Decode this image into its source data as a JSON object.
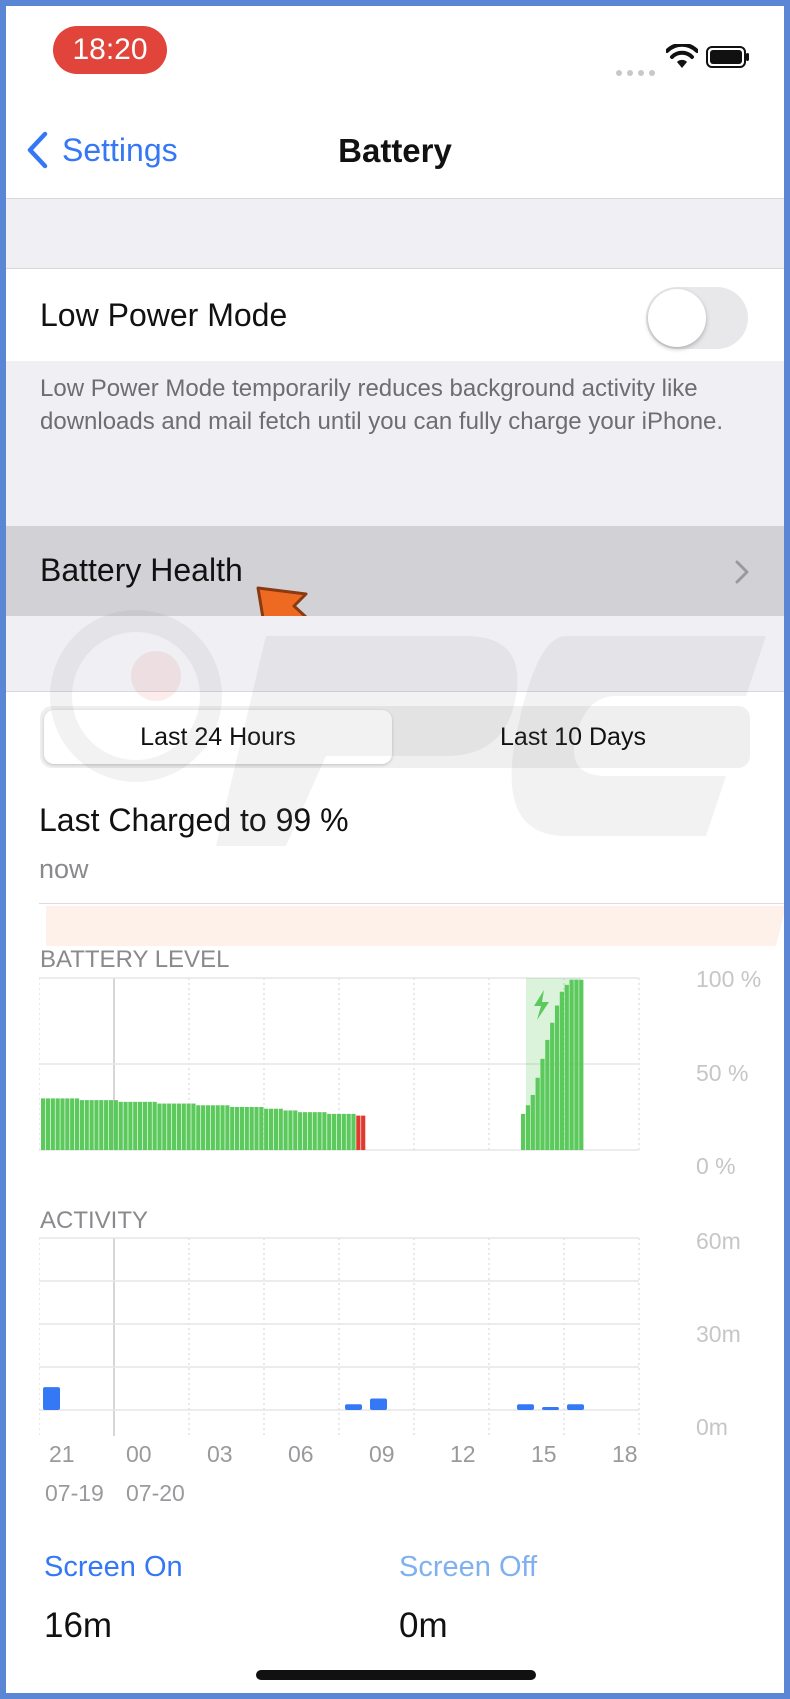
{
  "status_bar": {
    "time": "18:20"
  },
  "nav": {
    "back_label": "Settings",
    "title": "Battery"
  },
  "low_power": {
    "label": "Low Power Mode",
    "enabled": false,
    "description": "Low Power Mode temporarily reduces background activity like downloads and mail fetch until you can fully charge your iPhone."
  },
  "battery_health": {
    "label": "Battery Health"
  },
  "segments": {
    "selected": "Last 24 Hours",
    "other": "Last 10 Days"
  },
  "last_charged": {
    "title": "Last Charged to 99 %",
    "subtitle": "now"
  },
  "colors": {
    "accent": "#3478f6",
    "battery_green": "#5cc95c",
    "battery_red": "#e03a30",
    "screen_off_blue": "#7fb1f2",
    "annotation_arrow": "#ee6a22"
  },
  "chart_data": [
    {
      "type": "bar",
      "title": "BATTERY LEVEL",
      "y_ticks": [
        "100 %",
        "50 %",
        "0 %"
      ],
      "ylim": [
        0,
        100
      ],
      "x_tick_labels": [
        "21",
        "00",
        "03",
        "06",
        "09",
        "12",
        "15",
        "18"
      ],
      "x_date_labels": [
        "07-19",
        "07-20"
      ],
      "series": [
        {
          "values": [
            30,
            30,
            30,
            30,
            30,
            30,
            30,
            30,
            29,
            29,
            29,
            29,
            29,
            29,
            29,
            29,
            28,
            28,
            28,
            28,
            28,
            28,
            28,
            28,
            27,
            27,
            27,
            27,
            27,
            27,
            27,
            27,
            26,
            26,
            26,
            26,
            26,
            26,
            26,
            25,
            25,
            25,
            25,
            25,
            25,
            25,
            24,
            24,
            24,
            24,
            23,
            23,
            23,
            22,
            22,
            22,
            22,
            22,
            22,
            21,
            21,
            21,
            21,
            21,
            21
          ]
        },
        {
          "values": [
            20,
            20
          ]
        },
        {
          "values": [
            21,
            26,
            32,
            42,
            53,
            64,
            74,
            84,
            92,
            96,
            99,
            99,
            99
          ]
        }
      ]
    },
    {
      "type": "bar",
      "title": "ACTIVITY",
      "y_ticks": [
        "60m",
        "30m",
        "0m"
      ],
      "ylim": [
        0,
        60
      ],
      "x_tick_labels": [
        "21",
        "00",
        "03",
        "06",
        "09",
        "12",
        "15",
        "18"
      ],
      "x_date_labels": [
        "07-19",
        "07-20"
      ],
      "series": [
        {
          "values": [
            8,
            2,
            4,
            2,
            1,
            2
          ]
        }
      ]
    }
  ],
  "screen_usage": {
    "on_label": "Screen On",
    "on_value": "16m",
    "off_label": "Screen Off",
    "off_value": "0m"
  }
}
